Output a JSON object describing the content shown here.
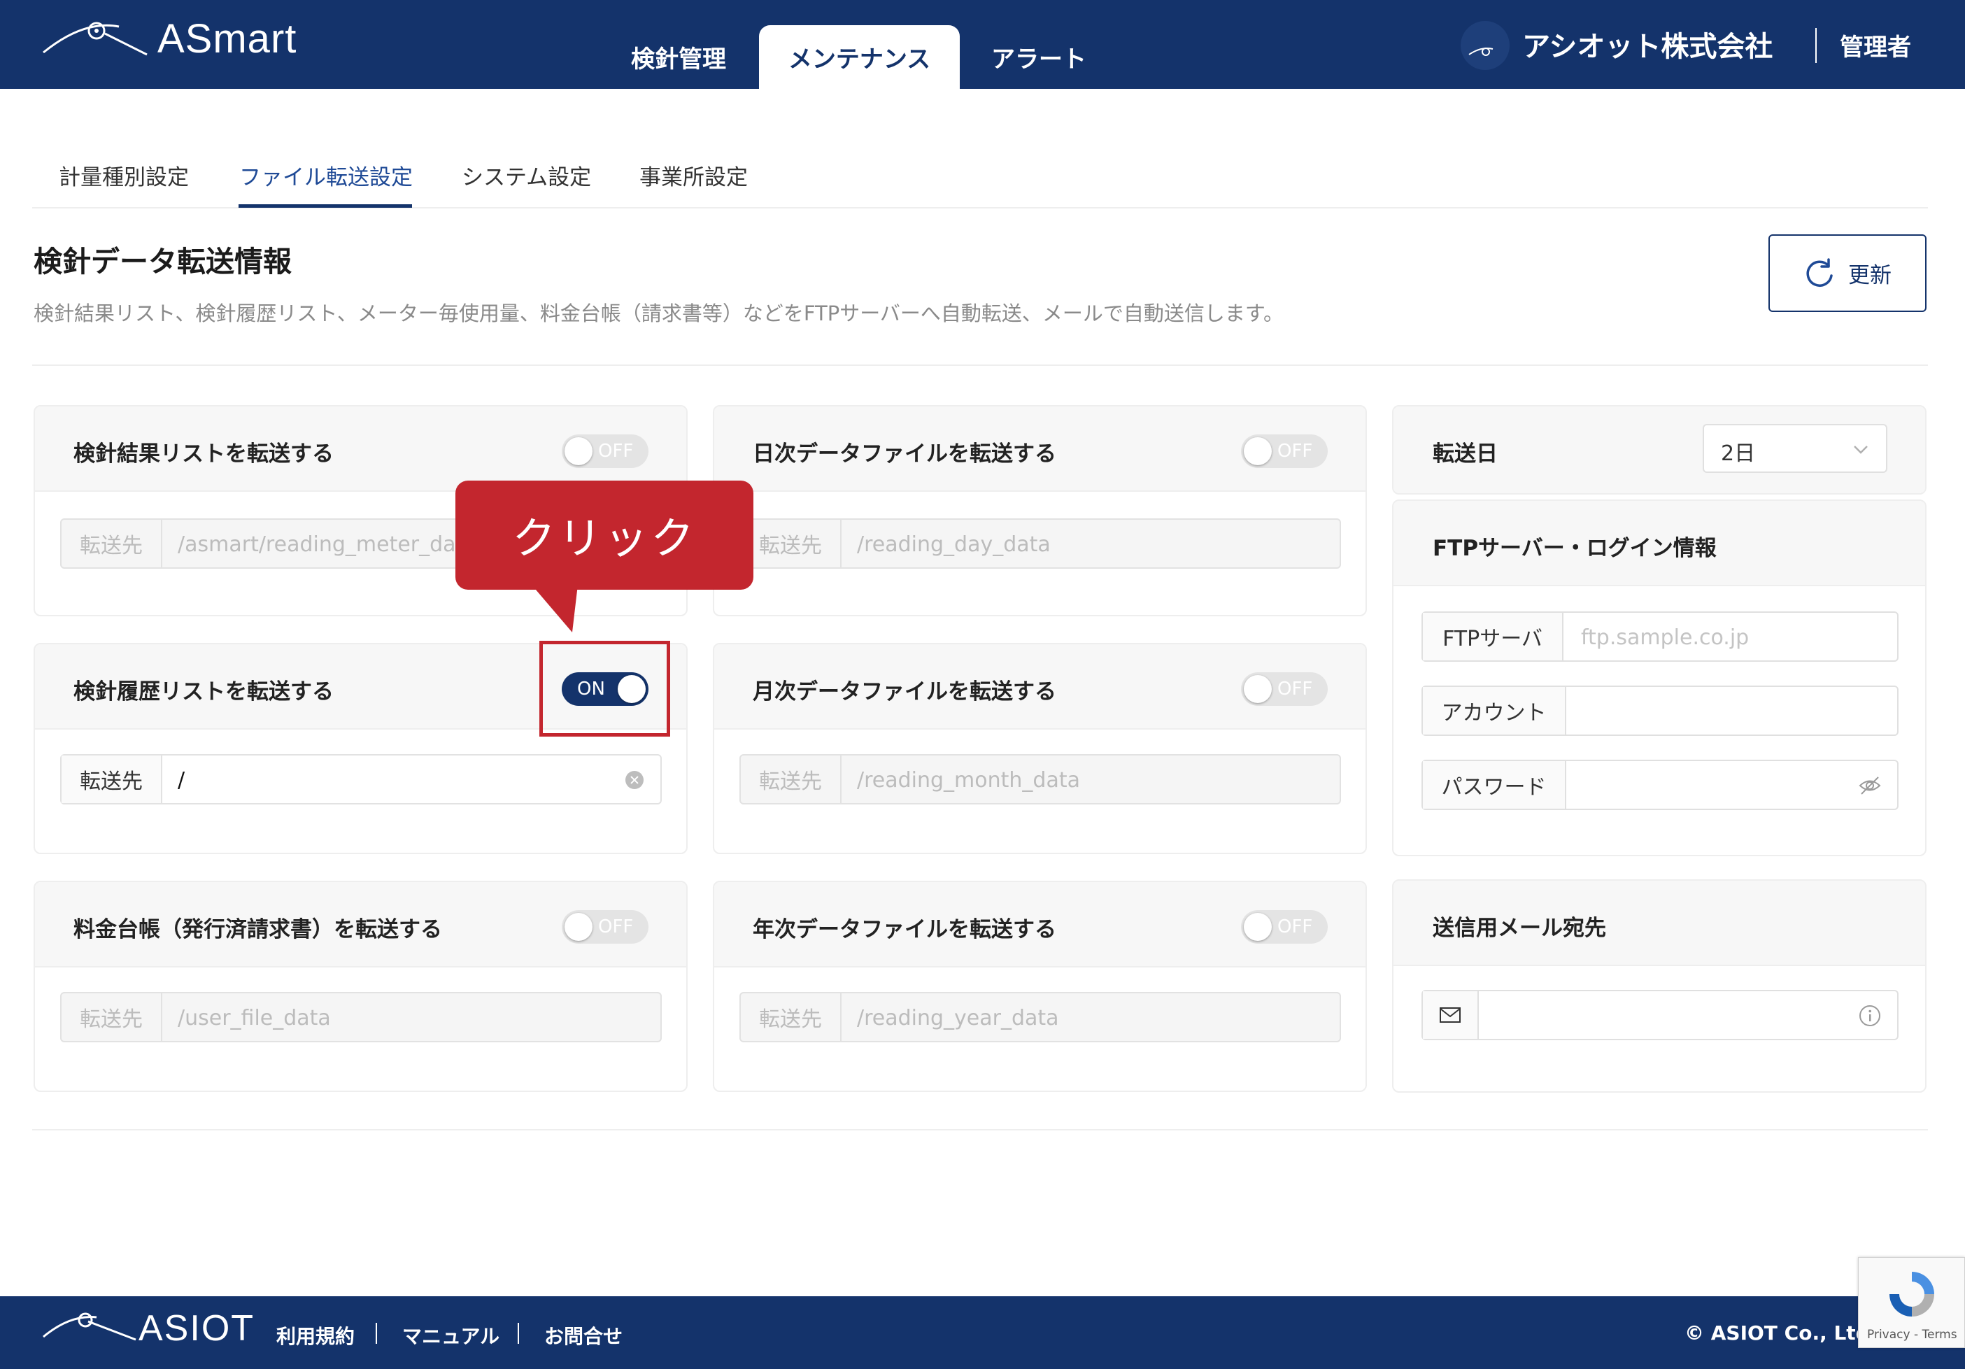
{
  "header": {
    "app_name": "ASmart",
    "tabs": [
      {
        "label": "検針管理",
        "active": false
      },
      {
        "label": "メンテナンス",
        "active": true
      },
      {
        "label": "アラート",
        "active": false
      }
    ],
    "company": "アシオット株式会社",
    "user": "管理者"
  },
  "subtabs": [
    {
      "label": "計量種別設定",
      "active": false
    },
    {
      "label": "ファイル転送設定",
      "active": true
    },
    {
      "label": "システム設定",
      "active": false
    },
    {
      "label": "事業所設定",
      "active": false
    }
  ],
  "page": {
    "title": "検針データ転送情報",
    "description": "検針結果リスト、検針履歴リスト、メーター毎使用量、料金台帳（請求書等）などをFTPサーバーへ自動転送、メールで自動送信します。",
    "refresh_label": "更新"
  },
  "cards": [
    {
      "title": "検針結果リストを転送する",
      "toggle": "OFF",
      "field_label": "転送先",
      "field_value": "/asmart/reading_meter_data"
    },
    {
      "title": "日次データファイルを転送する",
      "toggle": "OFF",
      "field_label": "転送先",
      "field_value": "/reading_day_data"
    },
    {
      "title": "検針履歴リストを転送する",
      "toggle": "ON",
      "field_label": "転送先",
      "field_value": "/"
    },
    {
      "title": "月次データファイルを転送する",
      "toggle": "OFF",
      "field_label": "転送先",
      "field_value": "/reading_month_data"
    },
    {
      "title": "料金台帳（発行済請求書）を転送する",
      "toggle": "OFF",
      "field_label": "転送先",
      "field_value": "/user_file_data"
    },
    {
      "title": "年次データファイルを転送する",
      "toggle": "OFF",
      "field_label": "転送先",
      "field_value": "/reading_year_data"
    }
  ],
  "transfer_day": {
    "label": "転送日",
    "value": "2日"
  },
  "ftp": {
    "title": "FTPサーバー・ログイン情報",
    "server_label": "FTPサーバ",
    "server_placeholder": "ftp.sample.co.jp",
    "account_label": "アカウント",
    "password_label": "パスワード"
  },
  "mail": {
    "title": "送信用メール宛先"
  },
  "callout": {
    "text": "クリック"
  },
  "footer": {
    "logo": "ASIOT",
    "links": [
      "利用規約",
      "マニュアル",
      "お問合せ"
    ],
    "copyright": "© ASIOT Co., Ltd."
  },
  "recaptcha": {
    "text": "Privacy - Terms"
  },
  "colors": {
    "navy": "#14336b",
    "accent_red": "#c3262e"
  }
}
